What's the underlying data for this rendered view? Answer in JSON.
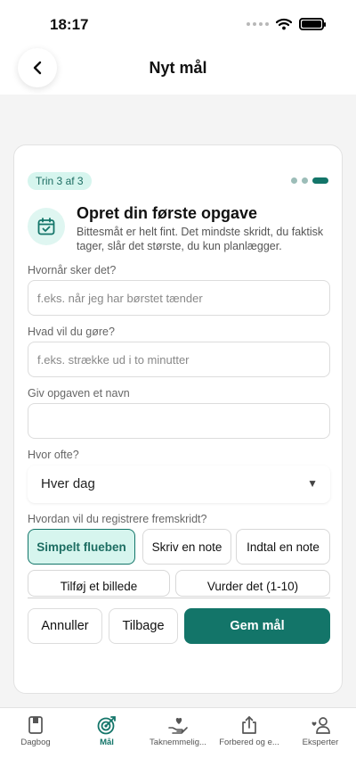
{
  "status_bar": {
    "time": "18:17"
  },
  "nav": {
    "title": "Nyt mål"
  },
  "step": {
    "badge": "Trin 3 af 3",
    "total": 3,
    "current": 3
  },
  "header": {
    "title": "Opret din første opgave",
    "subtitle": "Bittesmåt er helt fint. Det mindste skridt, du faktisk tager, slår det største, du kun planlægger."
  },
  "fields": {
    "when": {
      "label": "Hvornår sker det?",
      "placeholder": "f.eks. når jeg har børstet tænder",
      "value": ""
    },
    "what": {
      "label": "Hvad vil du gøre?",
      "placeholder": "f.eks. strække ud i to minutter",
      "value": ""
    },
    "name": {
      "label": "Giv opgaven et navn",
      "placeholder": "",
      "value": ""
    },
    "frequency": {
      "label": "Hvor ofte?",
      "value": "Hver dag"
    }
  },
  "progress": {
    "label": "Hvordan vil du registrere fremskridt?",
    "options": [
      "Simpelt flueben",
      "Skriv en note",
      "Indtal en note",
      "Tilføj et billede",
      "Vurder det (1-10)"
    ],
    "selected": "Simpelt flueben"
  },
  "actions": {
    "cancel": "Annuller",
    "back": "Tilbage",
    "save": "Gem mål"
  },
  "tabs": [
    {
      "label": "Dagbog",
      "icon": "book-icon"
    },
    {
      "label": "Mål",
      "icon": "target-icon",
      "active": true
    },
    {
      "label": "Taknemmelig...",
      "icon": "heart-hand-icon"
    },
    {
      "label": "Forbered og e...",
      "icon": "share-icon"
    },
    {
      "label": "Eksperter",
      "icon": "experts-icon"
    }
  ],
  "colors": {
    "accent": "#137569",
    "accent_light": "#d6f5ee",
    "background": "#f4f4f4"
  }
}
